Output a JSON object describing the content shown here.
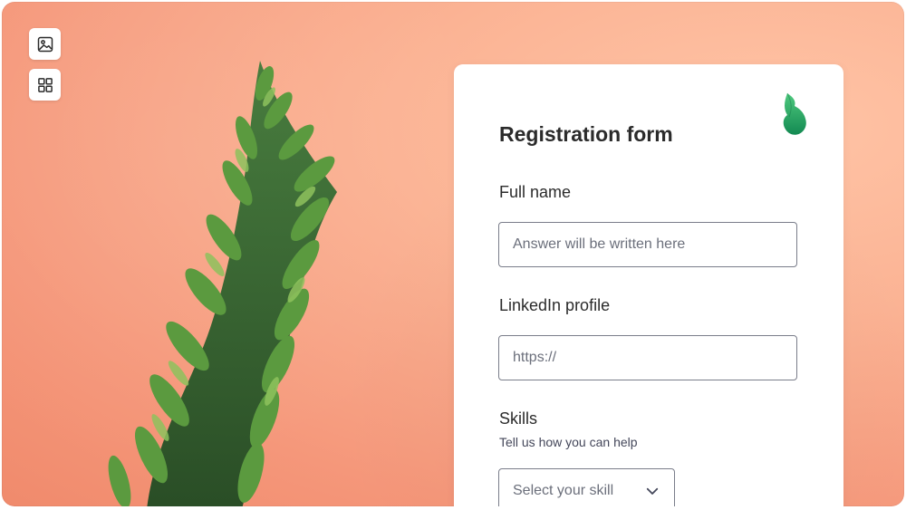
{
  "toolbar": {
    "image_icon": "image-icon",
    "grid_icon": "grid-icon"
  },
  "form": {
    "title": "Registration form",
    "logo_icon": "flame-leaf-logo",
    "fields": [
      {
        "label": "Full name",
        "placeholder": "Answer will be written here",
        "value": ""
      },
      {
        "label": "LinkedIn profile",
        "placeholder": "https://",
        "value": ""
      }
    ],
    "skills": {
      "label": "Skills",
      "sublabel": "Tell us how you can help",
      "selected": "Select your skill",
      "chevron_icon": "chevron-down-icon"
    }
  },
  "colors": {
    "background": "#f5977a",
    "card": "#ffffff",
    "accent": "#1fa364"
  }
}
